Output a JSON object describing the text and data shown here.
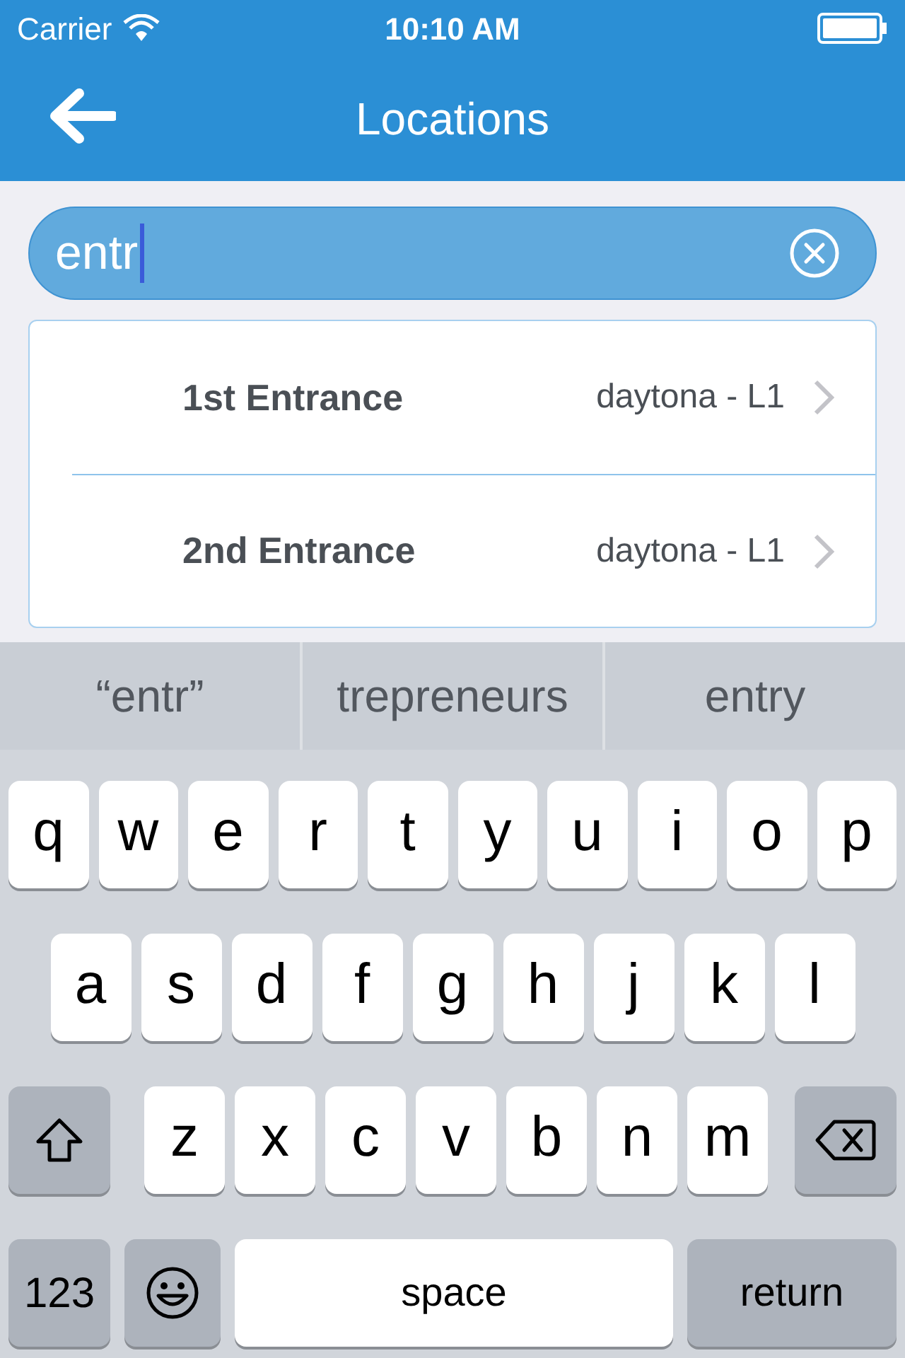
{
  "status_bar": {
    "carrier": "Carrier",
    "time": "10:10 AM"
  },
  "nav": {
    "title": "Locations"
  },
  "search": {
    "value": "entr"
  },
  "results": [
    {
      "name": "1st Entrance",
      "location": "daytona - L1"
    },
    {
      "name": "2nd Entrance",
      "location": "daytona - L1"
    }
  ],
  "suggestions": [
    "“entr”",
    "trepreneurs",
    "entry"
  ],
  "keyboard": {
    "top_row": [
      {
        "kind": "letter",
        "label": "q"
      },
      {
        "kind": "letter",
        "label": "w"
      },
      {
        "kind": "letter",
        "label": "e"
      },
      {
        "kind": "letter",
        "label": "r"
      },
      {
        "kind": "letter",
        "label": "t"
      },
      {
        "kind": "letter",
        "label": "y"
      },
      {
        "kind": "letter",
        "label": "u"
      },
      {
        "kind": "letter",
        "label": "i"
      },
      {
        "kind": "letter",
        "label": "o"
      },
      {
        "kind": "letter",
        "label": "p"
      }
    ],
    "middle_row": [
      {
        "kind": "letter",
        "label": "a"
      },
      {
        "kind": "letter",
        "label": "s"
      },
      {
        "kind": "letter",
        "label": "d"
      },
      {
        "kind": "letter",
        "label": "f"
      },
      {
        "kind": "letter",
        "label": "g"
      },
      {
        "kind": "letter",
        "label": "h"
      },
      {
        "kind": "letter",
        "label": "j"
      },
      {
        "kind": "letter",
        "label": "k"
      },
      {
        "kind": "letter",
        "label": "l"
      }
    ],
    "lower_row": [
      {
        "kind": "shift"
      },
      {
        "kind": "letter",
        "label": "z"
      },
      {
        "kind": "letter",
        "label": "x"
      },
      {
        "kind": "letter",
        "label": "c"
      },
      {
        "kind": "letter",
        "label": "v"
      },
      {
        "kind": "letter",
        "label": "b"
      },
      {
        "kind": "letter",
        "label": "n"
      },
      {
        "kind": "letter",
        "label": "m"
      },
      {
        "kind": "delete"
      }
    ],
    "function_row": [
      {
        "kind": "mode",
        "label": "123"
      },
      {
        "kind": "emoji"
      },
      {
        "kind": "space",
        "label": "space"
      },
      {
        "kind": "return",
        "label": "return"
      }
    ]
  }
}
